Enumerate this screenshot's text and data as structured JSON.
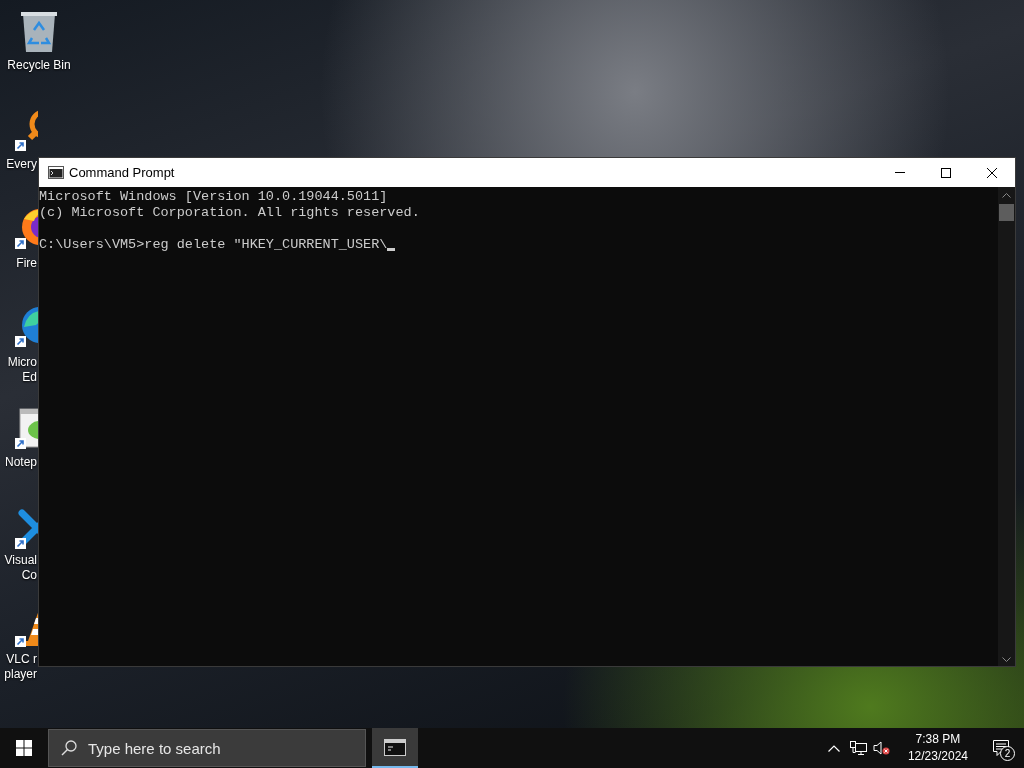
{
  "desktop_icons": [
    {
      "kind": "recycle-bin",
      "lines": [
        "Recycle Bin"
      ]
    },
    {
      "kind": "search-app",
      "lines": [
        "Every"
      ]
    },
    {
      "kind": "browser-orange",
      "lines": [
        "Fire"
      ]
    },
    {
      "kind": "browser-blue",
      "lines": [
        "Micro",
        "Ed"
      ]
    },
    {
      "kind": "notepad",
      "lines": [
        "Notep"
      ]
    },
    {
      "kind": "code-editor",
      "lines": [
        "Visual",
        "Co"
      ]
    },
    {
      "kind": "media-player",
      "lines": [
        "VLC r",
        "player"
      ]
    }
  ],
  "window": {
    "title": "Command Prompt",
    "console_lines": [
      {
        "text": "Microsoft Windows [Version 10.0.19044.5011]"
      },
      {
        "text": "(c) Microsoft Corporation. All rights reserved."
      },
      {
        "text": "C:\\Users\\VM5>reg delete \"HKEY_CURRENT_USER\\",
        "gap_before": true,
        "cursor": true
      }
    ]
  },
  "taskbar": {
    "search": {
      "placeholder": "Type here to search"
    },
    "apps": [
      {
        "kind": "console",
        "selected": true
      }
    ],
    "tray": {
      "volume_muted": true,
      "time": "7:38 PM",
      "date": "12/23/2024",
      "notification_count": "2"
    }
  }
}
